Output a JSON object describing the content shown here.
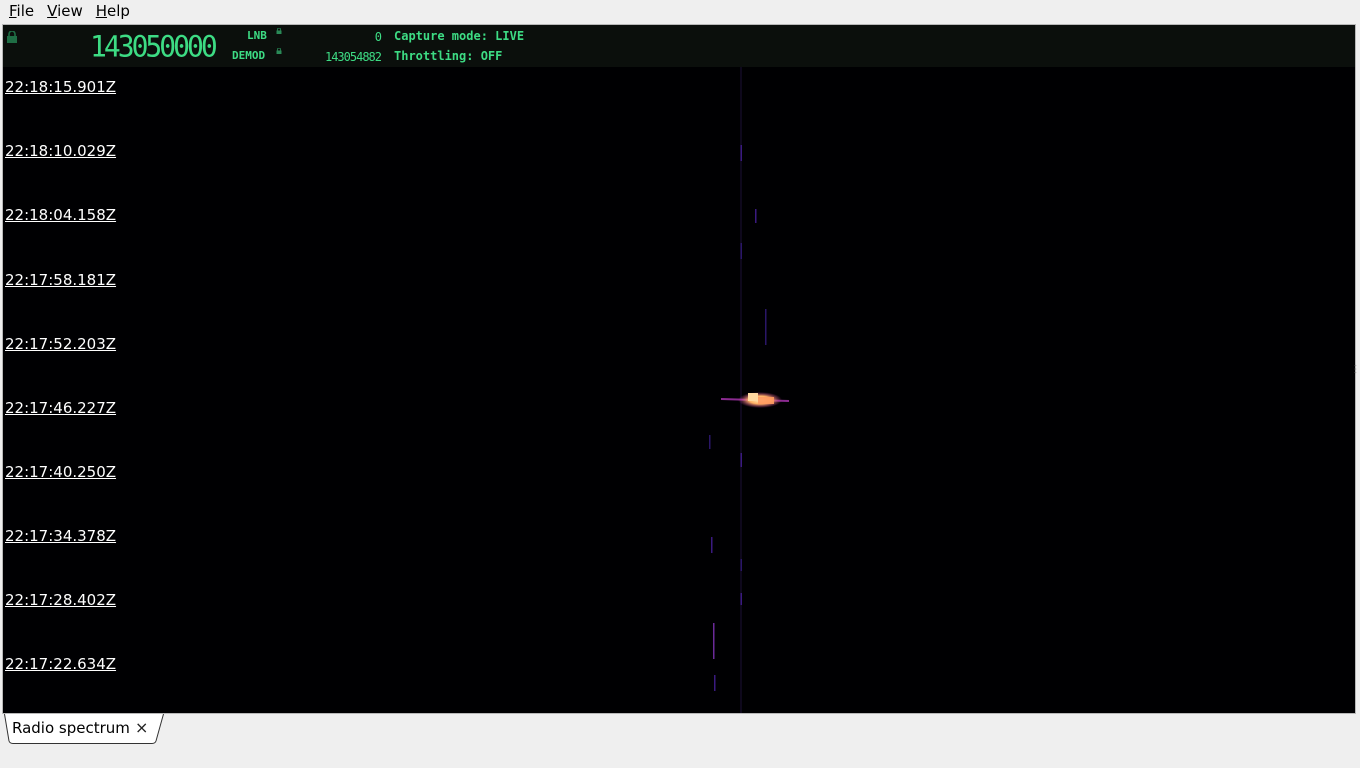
{
  "menu": [
    {
      "mnemonic": "F",
      "rest": "ile"
    },
    {
      "mnemonic": "V",
      "rest": "iew"
    },
    {
      "mnemonic": "H",
      "rest": "elp"
    }
  ],
  "header": {
    "frequency": "143050000",
    "lnb_label": "LNB",
    "lnb_value": "0",
    "demod_label": "DEMOD",
    "demod_value": "143054882",
    "capture_mode": "Capture mode: LIVE",
    "throttling": "Throttling: OFF"
  },
  "timestamps": [
    "22:18:15.901Z",
    "22:18:10.029Z",
    "22:18:04.158Z",
    "22:17:58.181Z",
    "22:17:52.203Z",
    "22:17:46.227Z",
    "22:17:40.250Z",
    "22:17:34.378Z",
    "22:17:28.402Z",
    "22:17:22.634Z"
  ],
  "tab": {
    "label": "Radio spectrum",
    "close": "×"
  },
  "colors": {
    "lcd_green": "#3ddc84",
    "waterfall_bg": "#000002",
    "signal_hot": "#ffc07a",
    "signal_mid": "#c03a9a",
    "signal_low": "#3a1a80"
  },
  "icons": [
    "lock-icon",
    "close-icon"
  ]
}
